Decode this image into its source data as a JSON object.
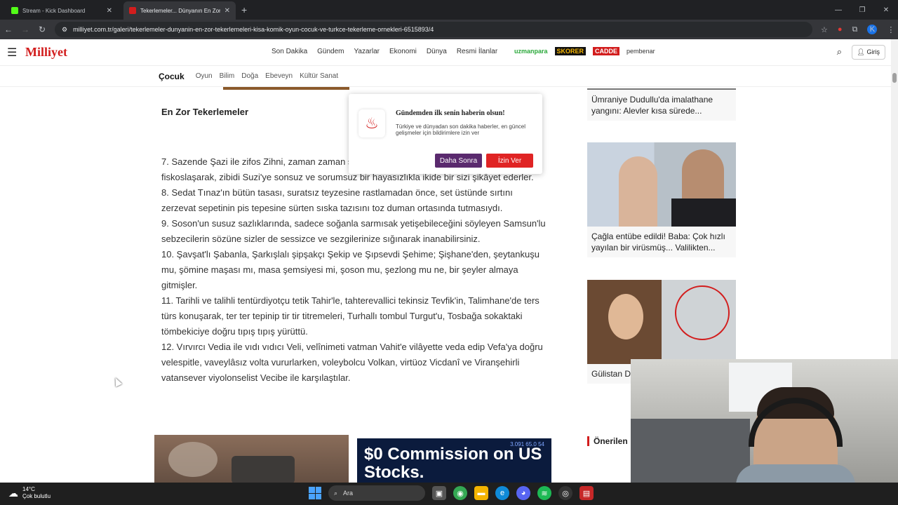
{
  "browser": {
    "tabs": [
      {
        "title": "Stream - Kick Dashboard",
        "favicon_color": "#53fc18"
      },
      {
        "title": "Tekerlemeler... Dünyanın En Zor",
        "favicon_color": "#d21d1d"
      }
    ],
    "url": "milliyet.com.tr/galeri/tekerlemeler-dunyanin-en-zor-tekerlemeleri-kisa-komik-oyun-cocuk-ve-turkce-tekerleme-ornekleri-6515893/4",
    "avatar_letter": "K"
  },
  "site": {
    "logo": "Milliyet",
    "topnav": [
      "Son Dakika",
      "Gündem",
      "Yazarlar",
      "Ekonomi",
      "Dünya",
      "Resmi İlanlar"
    ],
    "brands": {
      "uzman": "uzmanpara",
      "skorer": "SKORER",
      "cadde": "CADDE",
      "pembe": "pembenar"
    },
    "login": "Giriş",
    "subnav_title": "Çocuk",
    "subnav": [
      "Oyun",
      "Bilim",
      "Doğa",
      "Ebeveyn",
      "Kültür Sanat"
    ]
  },
  "article": {
    "heading": "En Zor Tekerlemeler",
    "lines": [
      "7. Sazende Şazi ile zifos Zihni, zaman zaman sizin sokağın sağ köşesinde sinsi sinsi fiskoslaşarak, zibidi Suzi'ye sonsuz ve sorumsuz bir hayasızlıkla ikide bir sizi şikâyet ederler.",
      "8. Sedat Tınaz'ın bütün tasası, suratsız teyzesine rastlamadan önce, set üstünde sırtını zerzevat sepetinin pis tepesine sürten sıska tazısını toz duman ortasında tutmasıydı.",
      "9. Soson'un susuz sazlıklarında, sadece soğanla sarmısak yetişebileceğini söyleyen Samsun'lu sebzecilerin sözüne sizler de sessizce ve sezgilerinize sığınarak inanabilirsiniz.",
      "10. Şavşat'lı Şabanla, Şarkışlalı şipşakçı Şekip ve Şıpsevdi Şehime; Şişhane'den, şeytankuşu mu, şömine maşası mı, masa şemsiyesi mi, şoson mu, şezlong mu ne, bir şeyler almaya gitmişler.",
      "11. Tarihli ve talihli tentürdiyotçu tetik Tahir'le, tahterevallici tekinsiz Tevfik'in, Talimhane'de ters türs konuşarak, ter ter tepinip tir tir titremeleri, Turhallı tombul Turgut'u, Tosbağa sokaktaki tömbekiciye doğru tıpış tıpış yürüttü.",
      "12. Vırvırcı Vedia ile vıdı vıdıcı Veli, velînimeti vatman Vahit'e vilâyette veda edip Vefa'ya doğru velespitle, vaveylâsız volta vururlarken, voleybolcu Volkan, virtüoz Vicdanî ve Viranşehirli vatansever viyolonselist Vecibe ile karşılaştılar."
    ],
    "ad2_text": "$0 Commission on US Stocks.",
    "ad2_ticker": "3.091  65.0  54"
  },
  "sidebar": {
    "cards": [
      {
        "caption": "Ümraniye Dudullu'da imalathane yangını: Alevler kısa sürede..."
      },
      {
        "caption": "Çağla entübe edildi! Baba: Çok hızlı yayılan bir virüsmüş... Valilikten..."
      },
      {
        "caption": "Gülistan D... aşama! Do..."
      }
    ],
    "section_title": "Önerilen"
  },
  "popup": {
    "title": "Gündemden ilk senin haberin olsun!",
    "body": "Türkiye ve dünyadan son dakika haberler, en güncel gelişmeler için bildirimlere izin ver",
    "later": "Daha Sonra",
    "allow": "İzin Ver"
  },
  "taskbar": {
    "temp": "14°C",
    "weather": "Çok bulutlu",
    "search": "Ara"
  }
}
